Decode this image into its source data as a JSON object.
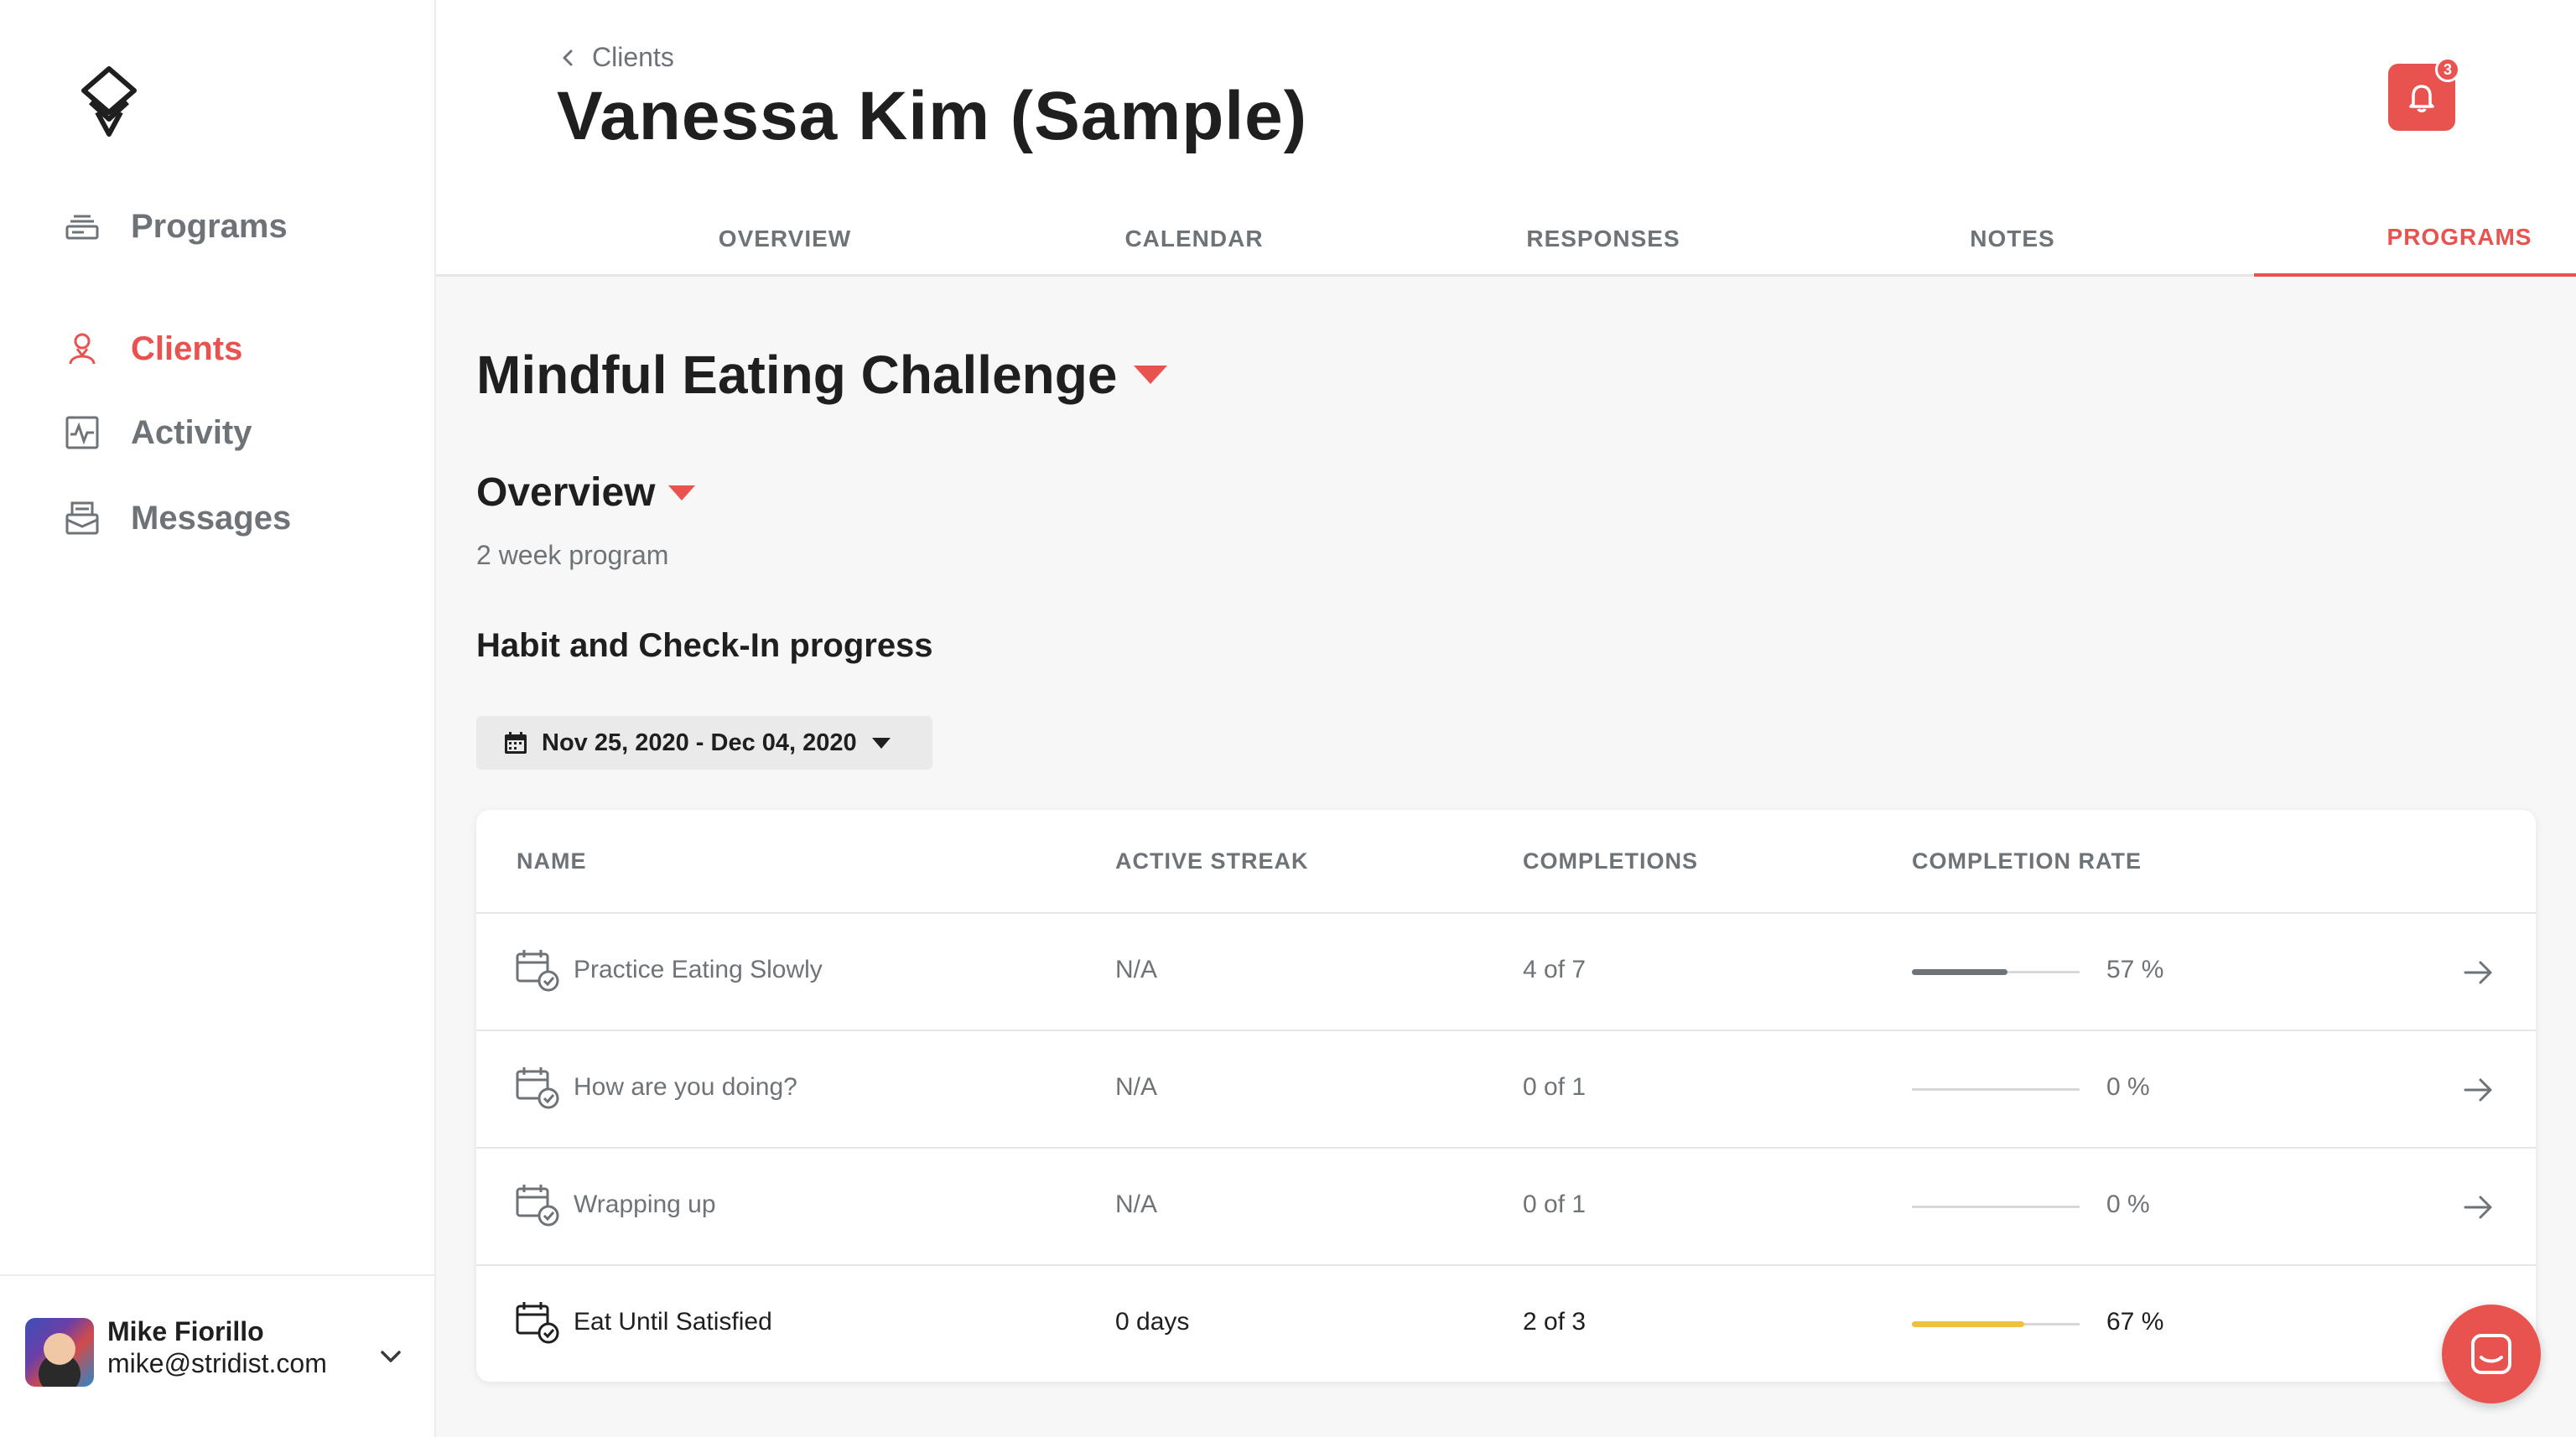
{
  "sidebar": {
    "items": [
      {
        "label": "Programs",
        "icon": "programs-icon"
      },
      {
        "label": "Clients",
        "icon": "clients-icon"
      },
      {
        "label": "Activity",
        "icon": "activity-icon"
      },
      {
        "label": "Messages",
        "icon": "messages-icon"
      }
    ],
    "active": "Clients",
    "user": {
      "name": "Mike Fiorillo",
      "email": "mike@stridist.com"
    }
  },
  "header": {
    "breadcrumb": "Clients",
    "title": "Vanessa Kim (Sample)",
    "notification_count": "3",
    "tabs": [
      {
        "label": "OVERVIEW"
      },
      {
        "label": "CALENDAR"
      },
      {
        "label": "RESPONSES"
      },
      {
        "label": "NOTES"
      },
      {
        "label": "PROGRAMS"
      }
    ],
    "active_tab": "PROGRAMS"
  },
  "main": {
    "program_title": "Mindful Eating Challenge",
    "overview_title": "Overview",
    "program_length": "2 week program",
    "progress_heading": "Habit and Check-In progress",
    "date_range": "Nov 25, 2020 - Dec 04, 2020",
    "table": {
      "columns": [
        "NAME",
        "ACTIVE STREAK",
        "COMPLETIONS",
        "COMPLETION RATE"
      ],
      "rows": [
        {
          "name": "Practice Eating Slowly",
          "streak": "N/A",
          "completions": "4 of 7",
          "rate_label": "57 %",
          "rate": 0.57,
          "bar_color": "#6e7378"
        },
        {
          "name": "How are you doing?",
          "streak": "N/A",
          "completions": "0 of 1",
          "rate_label": "0 %",
          "rate": 0,
          "bar_color": "#6e7378"
        },
        {
          "name": "Wrapping up",
          "streak": "N/A",
          "completions": "0 of 1",
          "rate_label": "0 %",
          "rate": 0,
          "bar_color": "#6e7378"
        },
        {
          "name": "Eat Until Satisfied",
          "streak": "0 days",
          "completions": "2 of 3",
          "rate_label": "67 %",
          "rate": 0.67,
          "bar_color": "#f0c040"
        }
      ]
    }
  },
  "colors": {
    "accent": "#e8534f",
    "muted": "#6e7378",
    "text": "#1f1f1f",
    "progress_highlight": "#f0c040"
  }
}
